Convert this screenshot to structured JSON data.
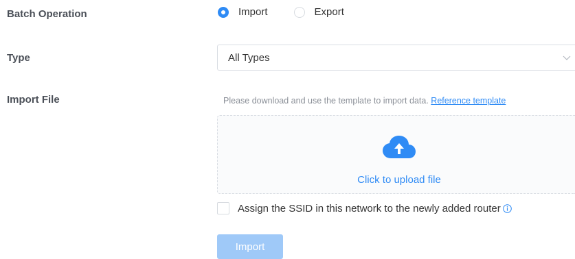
{
  "form": {
    "batch_operation": {
      "label": "Batch Operation",
      "options": [
        "Import",
        "Export"
      ],
      "selected": "Import"
    },
    "type": {
      "label": "Type",
      "value": "All Types",
      "chevron_icon": "chevron-down-icon"
    },
    "import_file": {
      "label": "Import File",
      "hint": "Please download and use the template to import data.",
      "reference_link": "Reference template",
      "upload_text": "Click to upload file",
      "upload_icon": "cloud-upload-icon"
    },
    "assign_ssid": {
      "label": "Assign the SSID in this network to the newly added router",
      "checked": false,
      "info_icon": "info-icon"
    },
    "submit_label": "Import"
  },
  "colors": {
    "accent": "#2f8bf5",
    "button_disabled": "#9fc9f8",
    "label": "#4a4f57",
    "hint": "#8b9098"
  }
}
